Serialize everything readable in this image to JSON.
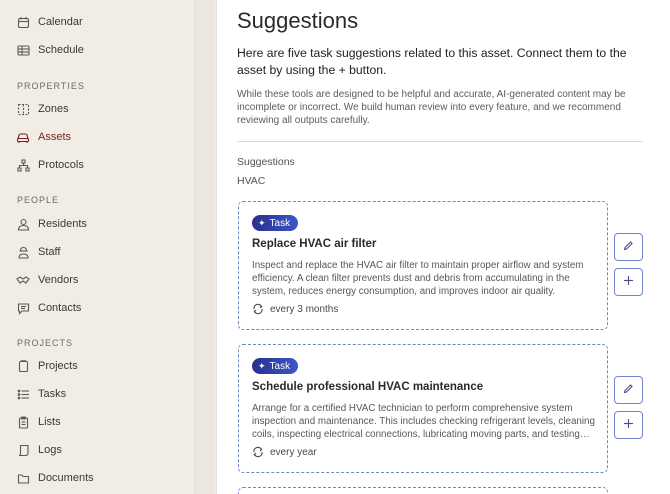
{
  "sidebar": {
    "items_top": [
      {
        "label": "Calendar",
        "icon": "calendar-icon"
      },
      {
        "label": "Schedule",
        "icon": "schedule-icon"
      }
    ],
    "sections": [
      {
        "heading": "PROPERTIES",
        "items": [
          {
            "label": "Zones",
            "icon": "zones-icon"
          },
          {
            "label": "Assets",
            "icon": "assets-icon",
            "active": true
          },
          {
            "label": "Protocols",
            "icon": "protocols-icon"
          }
        ]
      },
      {
        "heading": "PEOPLE",
        "items": [
          {
            "label": "Residents",
            "icon": "residents-icon"
          },
          {
            "label": "Staff",
            "icon": "staff-icon"
          },
          {
            "label": "Vendors",
            "icon": "vendors-icon"
          },
          {
            "label": "Contacts",
            "icon": "contacts-icon"
          }
        ]
      },
      {
        "heading": "PROJECTS",
        "items": [
          {
            "label": "Projects",
            "icon": "projects-icon"
          },
          {
            "label": "Tasks",
            "icon": "tasks-icon"
          },
          {
            "label": "Lists",
            "icon": "lists-icon"
          },
          {
            "label": "Logs",
            "icon": "logs-icon"
          },
          {
            "label": "Documents",
            "icon": "documents-icon"
          }
        ]
      }
    ]
  },
  "main": {
    "title": "Suggestions",
    "lead": "Here are five task suggestions related to this asset. Connect them to the asset by using the + button.",
    "note": "While these tools are designed to be helpful and accurate, AI-generated content may be incomplete or incorrect. We build human review into every feature, and we recommend reviewing all outputs carefully.",
    "suggestions_heading": "Suggestions",
    "category": "HVAC",
    "cards": [
      {
        "badge": "Task",
        "title": "Replace HVAC air filter",
        "description": "Inspect and replace the HVAC air filter to maintain proper airflow and system efficiency. A clean filter prevents dust and debris from accumulating in the system, reduces energy consumption, and improves indoor air quality.",
        "frequency": "every 3 months"
      },
      {
        "badge": "Task",
        "title": "Schedule professional HVAC maintenance",
        "description": "Arrange for a certified HVAC technician to perform comprehensive system inspection and maintenance. This includes checking refrigerant levels, cleaning coils, inspecting electrical connections, lubricating moving parts, and testing system performance.",
        "frequency": "every year"
      }
    ]
  },
  "colors": {
    "accent": "#7a1f1f",
    "card_border": "#6f86c9",
    "badge_start": "#2a2f8c",
    "badge_end": "#3b57c8",
    "sidebar_bg": "#f1ede4"
  }
}
